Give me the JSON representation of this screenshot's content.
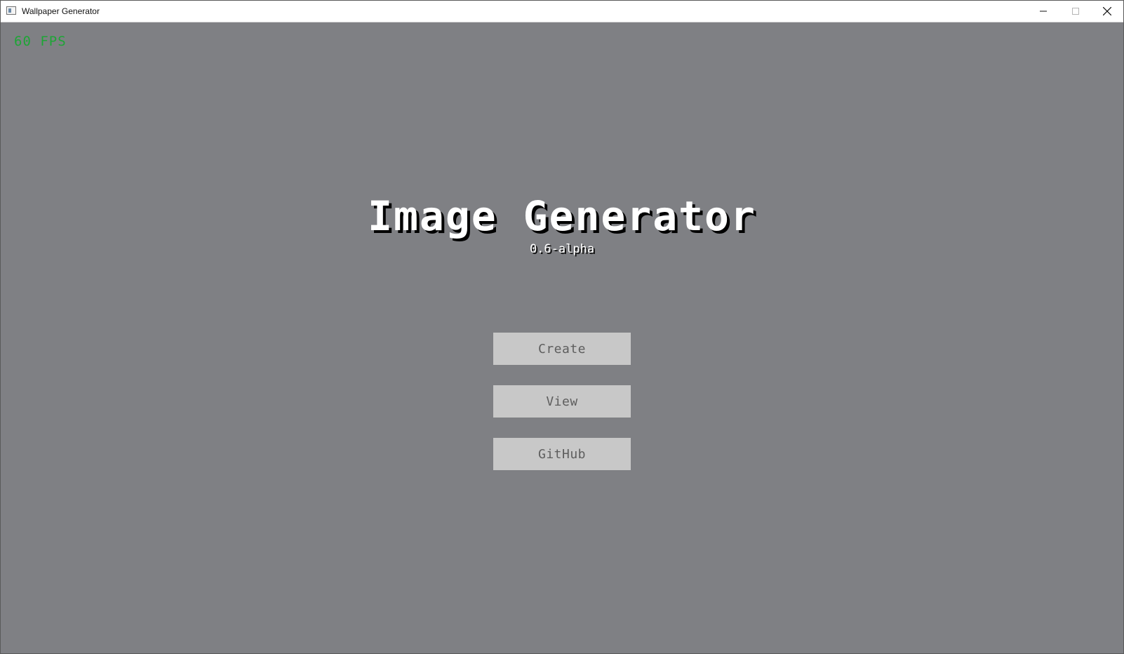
{
  "window": {
    "title": "Wallpaper Generator"
  },
  "hud": {
    "fps": "60 FPS"
  },
  "main": {
    "title": "Image Generator",
    "version": "0.6-alpha",
    "buttons": {
      "create": "Create",
      "view": "View",
      "github": "GitHub"
    }
  },
  "icons": {
    "app": "window-app-icon",
    "minimize": "minimize-icon",
    "maximize": "maximize-icon",
    "close": "close-icon"
  },
  "colors": {
    "background": "#7f8084",
    "fps": "#1ea536",
    "button": "#c8c8c8",
    "button_text": "#5e5e5e",
    "title": "#ffffff",
    "title_shadow": "#000000"
  }
}
